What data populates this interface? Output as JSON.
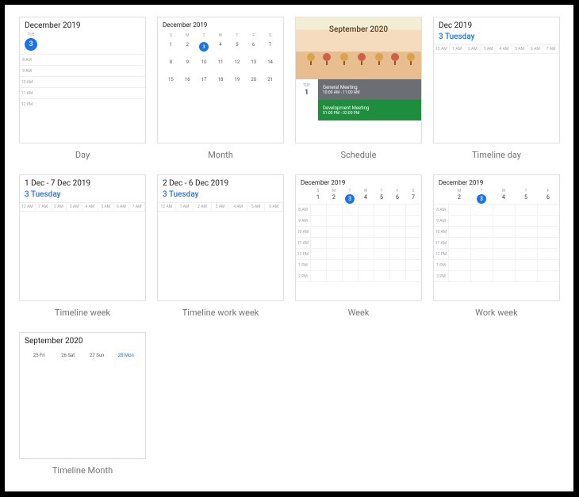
{
  "cards": {
    "day": {
      "title": "December 2019",
      "dow": "TUE",
      "date": "3",
      "hours": [
        "8 AM",
        "9 AM",
        "10 AM",
        "11 AM",
        "12 PM"
      ],
      "label": "Day"
    },
    "month": {
      "title": "December 2019",
      "dow": [
        "S",
        "M",
        "T",
        "W",
        "T",
        "F",
        "S"
      ],
      "weeks": [
        [
          "1",
          "2",
          "3",
          "4",
          "5",
          "6",
          "7"
        ],
        [
          "8",
          "9",
          "10",
          "11",
          "12",
          "13",
          "14"
        ],
        [
          "15",
          "16",
          "17",
          "18",
          "19",
          "20",
          "21"
        ]
      ],
      "today_index": 2,
      "label": "Month"
    },
    "schedule": {
      "month": "September 2020",
      "date_dow": "TUE",
      "date_num": "1",
      "events": [
        {
          "title": "General Meeting",
          "time": "10:00 AM - 11:00 AM",
          "color": "#6b6f73"
        },
        {
          "title": "Development Meeting",
          "time": "01:00 PM - 02:00 PM",
          "color": "#1e8e3e"
        }
      ],
      "label": "Schedule"
    },
    "timeline_day": {
      "title": "Dec 2019",
      "day": "3 Tuesday",
      "hours": [
        "12 AM",
        "1 AM",
        "2 AM",
        "3 AM",
        "4 AM",
        "5 AM",
        "6 AM",
        "7 AM"
      ],
      "label": "Timeline day"
    },
    "timeline_week": {
      "title": "1 Dec - 7 Dec 2019",
      "day": "3 Tuesday",
      "hours": [
        "12 AM",
        "1 AM",
        "2 AM",
        "3 AM",
        "4 AM",
        "5 AM",
        "6 AM",
        "7 AM"
      ],
      "label": "Timeline week"
    },
    "timeline_work_week": {
      "title": "2 Dec - 6 Dec 2019",
      "day": "3 Tuesday",
      "hours": [
        "12 AM",
        "1 AM",
        "2 AM",
        "3 AM",
        "4 AM",
        "5 AM",
        "6 AM"
      ],
      "label": "Timeline work week"
    },
    "week": {
      "title": "December 2019",
      "dow": [
        "S",
        "M",
        "T",
        "W",
        "T",
        "F",
        "S"
      ],
      "dates": [
        "1",
        "2",
        "3",
        "4",
        "5",
        "6",
        "7"
      ],
      "today_index": 2,
      "hours": [
        "8 AM",
        "9 AM",
        "10 AM",
        "11 AM",
        "12 PM",
        "1 PM",
        "2 PM"
      ],
      "label": "Week"
    },
    "work_week": {
      "title": "December 2019",
      "dow": [
        "M",
        "T",
        "W",
        "T",
        "F"
      ],
      "dates": [
        "2",
        "3",
        "4",
        "5",
        "6"
      ],
      "today_index": 1,
      "hours": [
        "8 AM",
        "9 AM",
        "10 AM",
        "11 AM",
        "12 PM",
        "1 PM",
        "2 PM"
      ],
      "label": "Work week"
    },
    "timeline_month": {
      "title": "September 2020",
      "days": [
        "25 Fri",
        "26 Sat",
        "27 Sun",
        "28 Mon"
      ],
      "today_index": 3,
      "label": "Timeline Month"
    }
  }
}
